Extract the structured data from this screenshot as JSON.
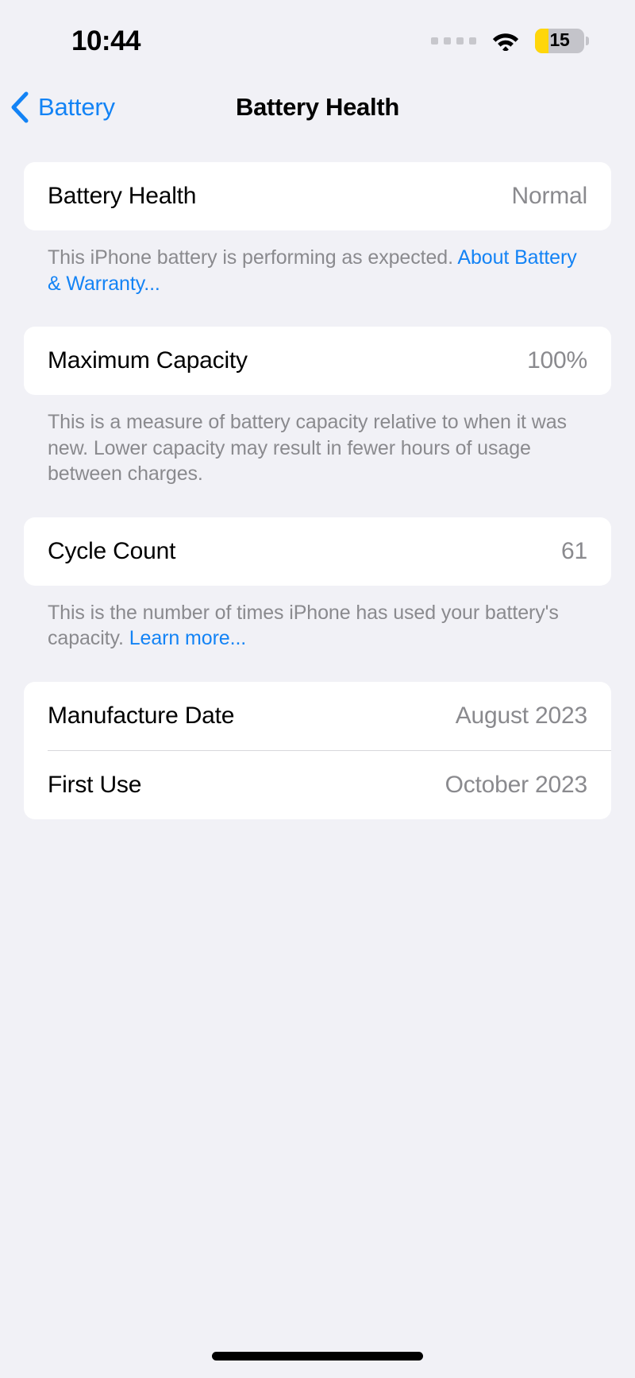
{
  "status_bar": {
    "time": "10:44",
    "signal_dots": 4,
    "wifi_icon": "wifi-icon",
    "battery": {
      "level_label": "15",
      "fill_color": "#FFD60A",
      "track_color": "#C4C4CA",
      "low_power_mode": true
    }
  },
  "nav": {
    "back_label": "Battery",
    "back_icon": "chevron-left-icon",
    "title": "Battery Health"
  },
  "sections": [
    {
      "rows": [
        {
          "label": "Battery Health",
          "value": "Normal"
        }
      ],
      "footer": {
        "text": "This iPhone battery is performing as expected. ",
        "link": "About Battery & Warranty..."
      }
    },
    {
      "rows": [
        {
          "label": "Maximum Capacity",
          "value": "100%"
        }
      ],
      "footer": {
        "text": "This is a measure of battery capacity relative to when it was new. Lower capacity may result in fewer hours of usage between charges.",
        "link": ""
      }
    },
    {
      "rows": [
        {
          "label": "Cycle Count",
          "value": "61"
        }
      ],
      "footer": {
        "text": "This is the number of times iPhone has used your battery's capacity. ",
        "link": "Learn more..."
      }
    },
    {
      "rows": [
        {
          "label": "Manufacture Date",
          "value": "August 2023"
        },
        {
          "label": "First Use",
          "value": "October 2023"
        }
      ],
      "footer": {
        "text": "",
        "link": ""
      }
    }
  ],
  "colors": {
    "accent_blue": "#1383F5",
    "page_background": "#F1F1F6",
    "card_background": "#FFFFFF",
    "secondary_text": "#8A8A8E"
  }
}
